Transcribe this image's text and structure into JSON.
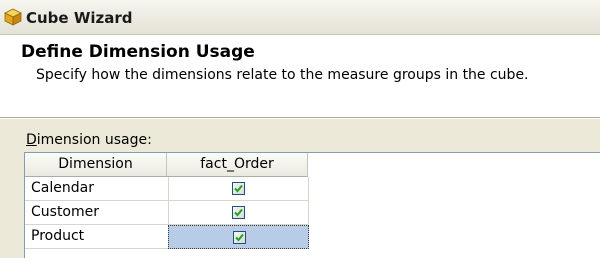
{
  "window": {
    "title": "Cube Wizard",
    "icon": "cube-icon"
  },
  "header": {
    "title": "Define Dimension Usage",
    "subtitle": "Specify how the dimensions relate to the measure groups in the cube."
  },
  "dimension_usage": {
    "label_mnemonic": "D",
    "label_rest": "imension usage:",
    "columns": [
      "Dimension",
      "fact_Order"
    ],
    "rows": [
      {
        "name": "Calendar",
        "checked": true,
        "selected": false
      },
      {
        "name": "Customer",
        "checked": true,
        "selected": false
      },
      {
        "name": "Product",
        "checked": true,
        "selected": true
      }
    ]
  },
  "colors": {
    "check": "#21a121",
    "selection": "#b8cce8",
    "grid_border": "#7f9db9"
  }
}
